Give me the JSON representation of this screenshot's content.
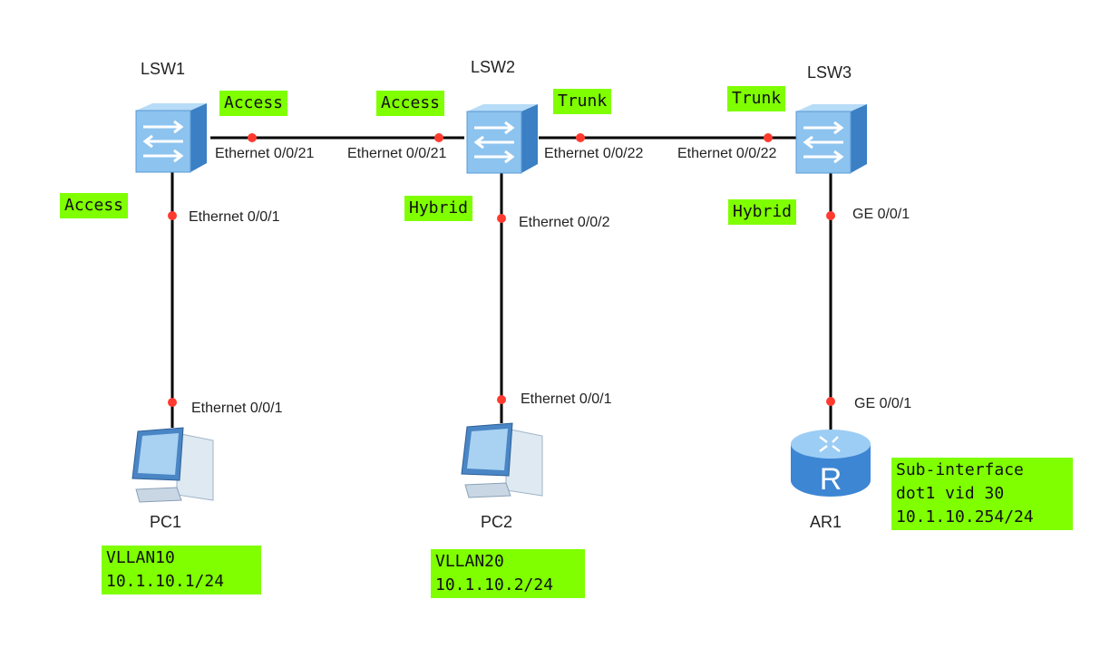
{
  "devices": {
    "lsw1": "LSW1",
    "lsw2": "LSW2",
    "lsw3": "LSW3",
    "pc1": "PC1",
    "pc2": "PC2",
    "ar1": "AR1"
  },
  "ports": {
    "lsw1_to_lsw2": "Ethernet 0/0/21",
    "lsw2_to_lsw1": "Ethernet 0/0/21",
    "lsw2_to_lsw3": "Ethernet 0/0/22",
    "lsw3_to_lsw2": "Ethernet 0/0/22",
    "lsw1_to_pc1": "Ethernet 0/0/1",
    "pc1_port": "Ethernet 0/0/1",
    "lsw2_to_pc2": "Ethernet 0/0/2",
    "pc2_port": "Ethernet 0/0/1",
    "lsw3_to_ar1": "GE 0/0/1",
    "ar1_port": "GE 0/0/1"
  },
  "port_modes": {
    "lsw1_uplink": "Access",
    "lsw2_to_lsw1": "Access",
    "lsw2_to_lsw3": "Trunk",
    "lsw3_to_lsw2": "Trunk",
    "lsw1_to_pc1": "Access",
    "lsw2_to_pc2": "Hybrid",
    "lsw3_to_ar1": "Hybrid"
  },
  "notes": {
    "pc1": [
      "VLLAN10",
      "10.1.10.1/24"
    ],
    "pc2": [
      "VLLAN20",
      "10.1.10.2/24"
    ],
    "ar1": [
      "Sub-interface",
      "dot1 vid 30",
      "10.1.10.254/24"
    ]
  },
  "colors": {
    "highlight": "#7fff00",
    "port_dot": "#ff3b30",
    "link": "#000000",
    "device_blue": "#6aaee8"
  }
}
